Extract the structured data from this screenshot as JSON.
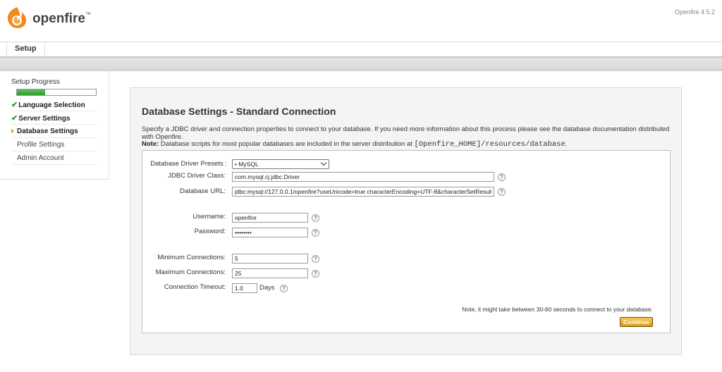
{
  "header": {
    "brand": "openfire",
    "brand_mark": "™",
    "version": "Openfire 4.5.2"
  },
  "tabs": [
    {
      "label": "Setup"
    }
  ],
  "sidebar": {
    "title": "Setup Progress",
    "progress": 0.36,
    "items": [
      {
        "label": "Language Selection",
        "status": "done"
      },
      {
        "label": "Server Settings",
        "status": "done"
      },
      {
        "label": "Database Settings",
        "status": "active"
      },
      {
        "label": "Profile Settings",
        "status": "pending"
      },
      {
        "label": "Admin Account",
        "status": "pending"
      }
    ],
    "check_glyph": "✔"
  },
  "main": {
    "title": "Database Settings - Standard Connection",
    "description": "Specify a JDBC driver and connection properties to connect to your database. If you need more information about this process please see the database documentation distributed with Openfire.",
    "note_label": "Note:",
    "note_text": "Database scripts for most popular databases are included in the server distribution at",
    "note_path": "[Openfire_HOME]/resources/database",
    "note_end": "."
  },
  "form": {
    "presets_label": "Database Driver Presets :",
    "presets_value": "• MySQL",
    "driver_label": "JDBC Driver Class:",
    "driver_value": "com.mysql.cj.jdbc.Driver",
    "url_label": "Database URL:",
    "url_value": "jdbc:mysql://127.0.0.1/openfire?useUnicode=true characterEncoding=UTF-8&characterSetResult",
    "username_label": "Username:",
    "username_value": "openfire",
    "password_label": "Password:",
    "password_value": "••••••••",
    "min_label": "Minimum Connections:",
    "min_value": "5",
    "max_label": "Maximum Connections:",
    "max_value": "25",
    "timeout_label": "Connection Timeout:",
    "timeout_value": "1.0",
    "timeout_unit": "Days",
    "help_glyph": "?",
    "connect_note": "Note, it might take between 30-60 seconds to connect to your database.",
    "continue_label": "Continue"
  },
  "colors": {
    "accent_orange": "#e8a000",
    "progress_green": "#2e9a2e",
    "button_gold": "#d99a1a"
  }
}
